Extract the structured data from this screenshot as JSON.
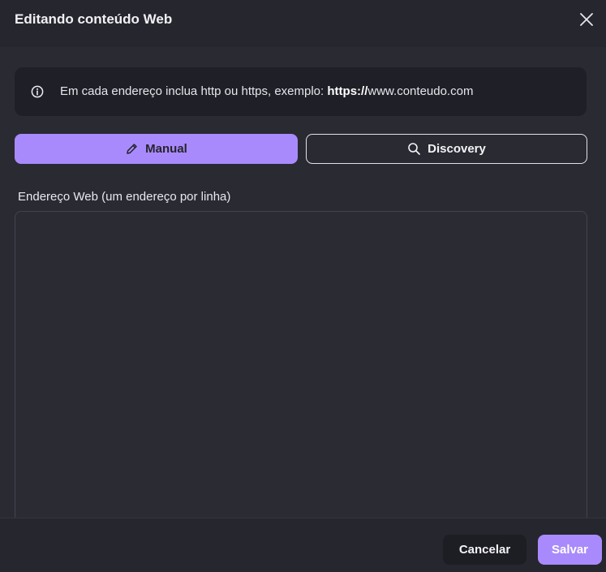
{
  "dialog": {
    "title": "Editando conteúdo Web",
    "close_icon": "close-icon"
  },
  "info": {
    "icon": "info-icon",
    "text_before": "Em cada endereço inclua http ou https, exemplo: ",
    "text_bold": "https://",
    "text_after": "www.conteudo.com"
  },
  "tabs": [
    {
      "label": "Manual",
      "icon": "pencil-icon",
      "active": true
    },
    {
      "label": "Discovery",
      "icon": "search-icon",
      "active": false
    }
  ],
  "field": {
    "label": "Endereço Web (um endereço por linha)",
    "value": "",
    "placeholder": ""
  },
  "footer": {
    "cancel_label": "Cancelar",
    "save_label": "Salvar"
  },
  "colors": {
    "accent": "#a98afc",
    "background": "#2a2a33",
    "header": "#26262f",
    "info_bar": "#1f1f27",
    "cancel_button": "#1d1d24"
  }
}
